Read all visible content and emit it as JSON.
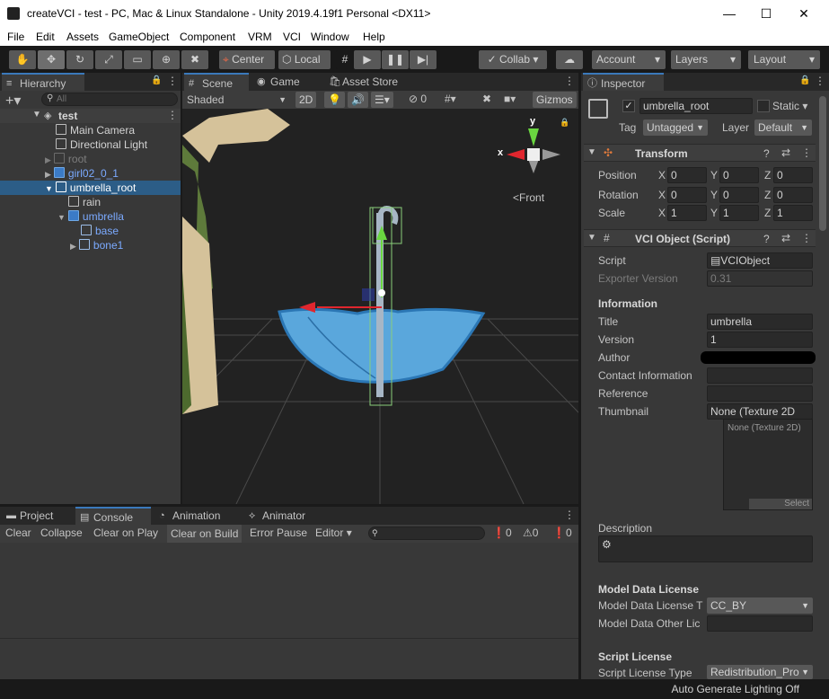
{
  "window": {
    "title": "createVCI - test - PC, Mac & Linux Standalone - Unity 2019.4.19f1 Personal <DX11>",
    "minimize": "—",
    "maximize": "☐",
    "close": "✕"
  },
  "menu": [
    "File",
    "Edit",
    "Assets",
    "GameObject",
    "Component",
    "VRM",
    "VCI",
    "Window",
    "Help"
  ],
  "toolbar": {
    "center": "Center",
    "local": "Local",
    "collab": "Collab ▾",
    "account": "Account",
    "layers": "Layers",
    "layout": "Layout"
  },
  "hierarchy": {
    "tab": "Hierarchy",
    "search_placeholder": "All",
    "scene": "test",
    "items": [
      {
        "label": "Main Camera"
      },
      {
        "label": "Directional Light"
      },
      {
        "label": "root"
      },
      {
        "label": "girl02_0_1"
      },
      {
        "label": "umbrella_root"
      },
      {
        "label": "rain"
      },
      {
        "label": "umbrella"
      },
      {
        "label": "base"
      },
      {
        "label": "bone1"
      }
    ]
  },
  "scene": {
    "tabs": {
      "scene": "Scene",
      "game": "Game",
      "asset_store": "Asset Store"
    },
    "shading": "Shaded",
    "mode_2d": "2D",
    "hidden_count": "0",
    "gizmos": "Gizmos",
    "view_label": "Front",
    "axis_x": "x",
    "axis_y": "y"
  },
  "console": {
    "tabs": {
      "project": "Project",
      "console": "Console",
      "animation": "Animation",
      "animator": "Animator"
    },
    "buttons": {
      "clear": "Clear",
      "collapse": "Collapse",
      "clear_on_play": "Clear on Play",
      "clear_on_build": "Clear on Build",
      "error_pause": "Error Pause",
      "editor": "Editor"
    },
    "counts": {
      "info": "0",
      "warn": "0",
      "error": "0"
    }
  },
  "inspector": {
    "tab": "Inspector",
    "object_name": "umbrella_root",
    "static": "Static",
    "tag_label": "Tag",
    "tag_value": "Untagged",
    "layer_label": "Layer",
    "layer_value": "Default",
    "transform": {
      "title": "Transform",
      "position_label": "Position",
      "rotation_label": "Rotation",
      "scale_label": "Scale",
      "axis_x": "X",
      "axis_y": "Y",
      "axis_z": "Z",
      "position": [
        "0",
        "0",
        "0"
      ],
      "rotation": [
        "0",
        "0",
        "0"
      ],
      "scale": [
        "1",
        "1",
        "1"
      ]
    },
    "vci": {
      "title": "VCI Object (Script)",
      "script_label": "Script",
      "script_value": "VCIObject",
      "exporter_label": "Exporter Version",
      "exporter_value": "0.31",
      "information": "Information",
      "title_label": "Title",
      "title_value": "umbrella",
      "version_label": "Version",
      "version_value": "1",
      "author_label": "Author",
      "contact_label": "Contact Information",
      "reference_label": "Reference",
      "thumbnail_label": "Thumbnail",
      "thumbnail_value": "None (Texture 2D",
      "thumb_box_label": "None (Texture 2D)",
      "select": "Select",
      "description_label": "Description",
      "model_license_header": "Model Data License",
      "model_license_label": "Model Data License T",
      "model_license_value": "CC_BY",
      "model_other_label": "Model Data Other Lic",
      "script_license_header": "Script License",
      "script_license_label": "Script License Type",
      "script_license_value": "Redistribution_Pro"
    }
  },
  "status": {
    "right": "Auto Generate Lighting Off"
  }
}
